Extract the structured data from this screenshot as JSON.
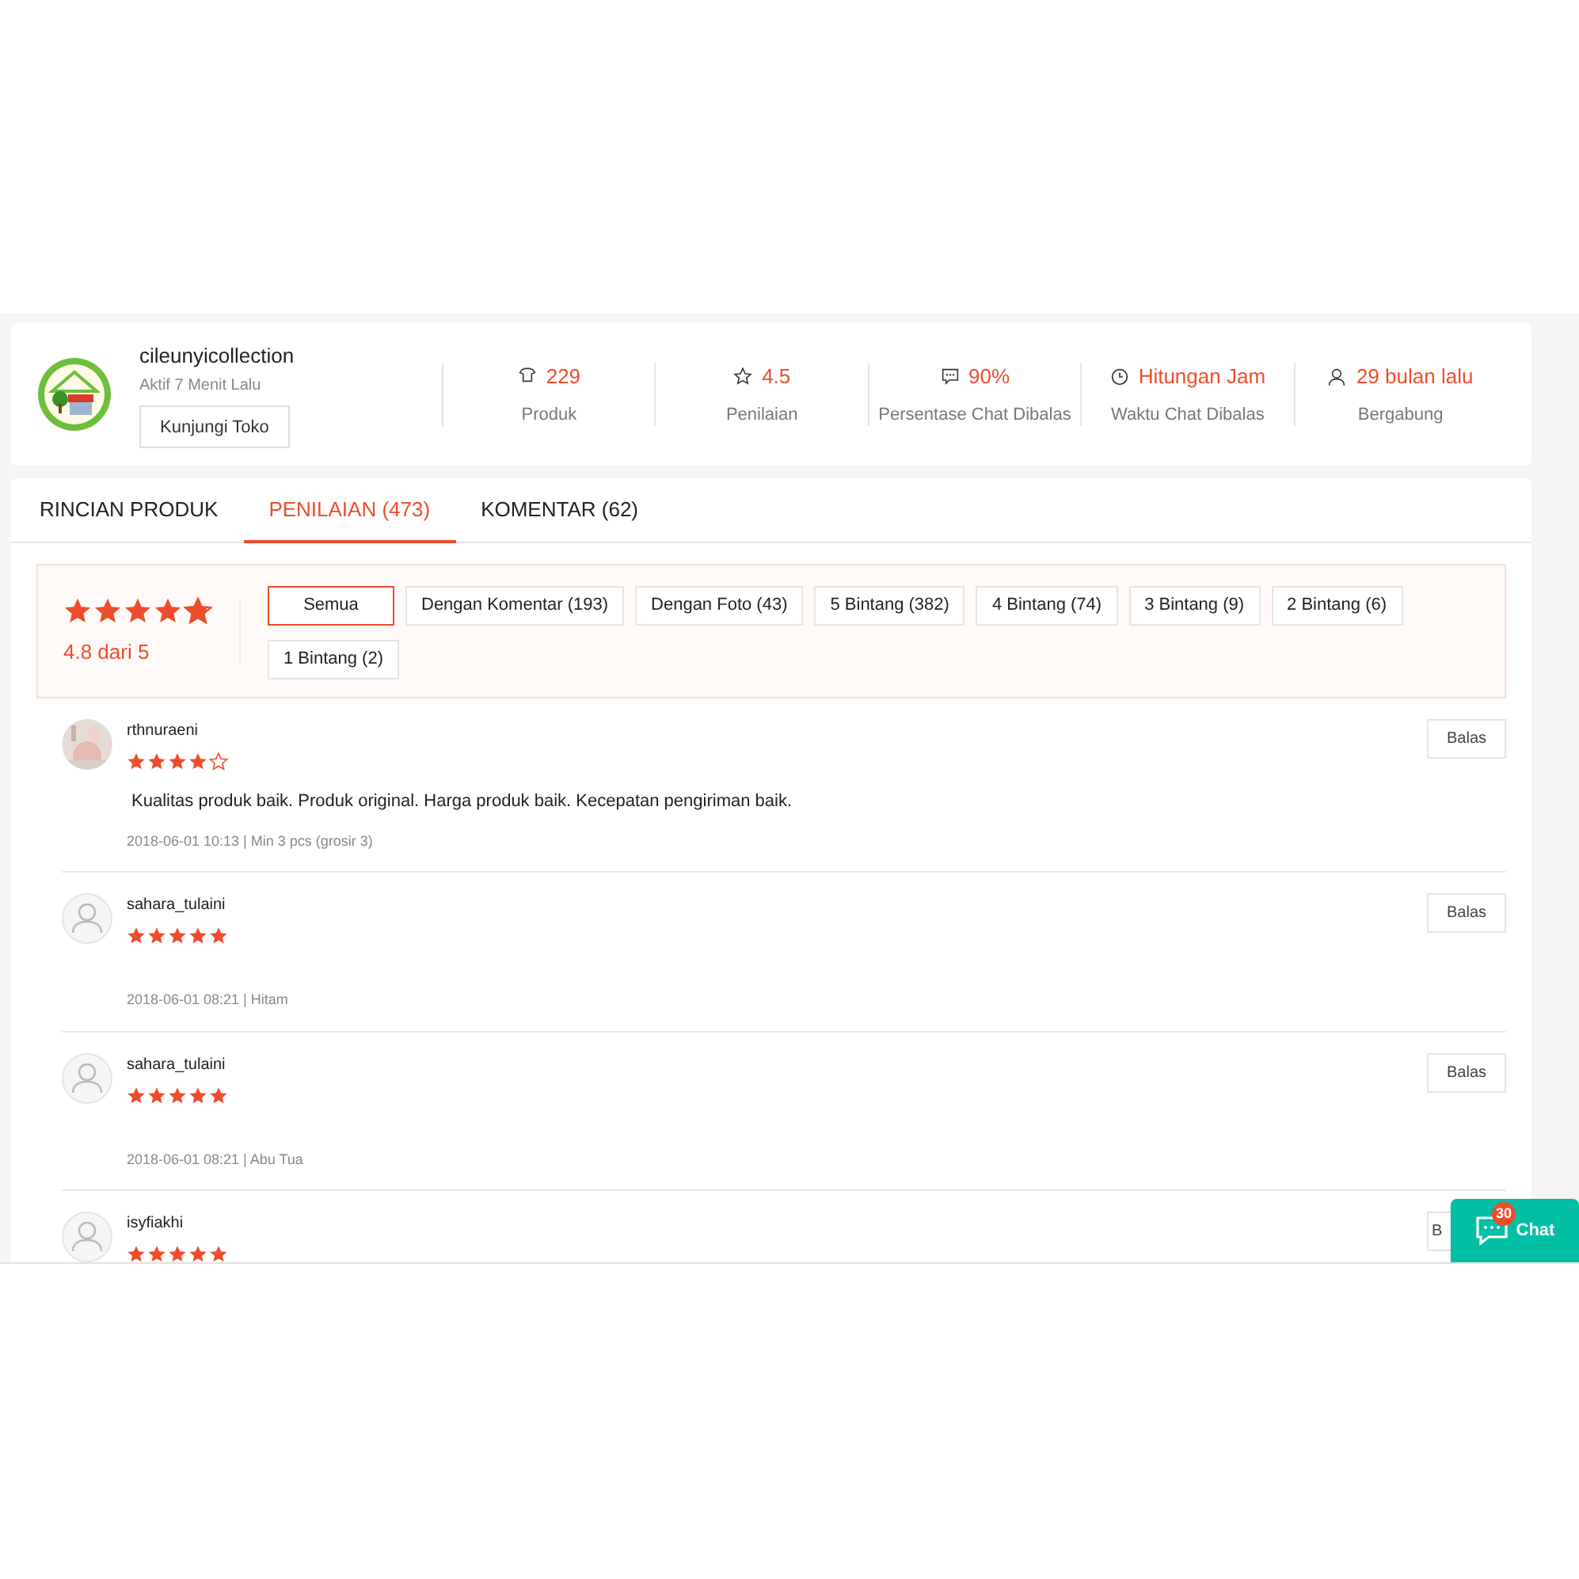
{
  "shop": {
    "name": "cileunyicollection",
    "status": "Aktif 7 Menit Lalu",
    "visit_button": "Kunjungi Toko"
  },
  "stats": [
    {
      "kind": "shirt",
      "value": "229",
      "label": "Produk"
    },
    {
      "kind": "star",
      "value": "4.5",
      "label": "Penilaian"
    },
    {
      "kind": "chat",
      "value": "90%",
      "label": "Persentase Chat Dibalas"
    },
    {
      "kind": "clock",
      "value": "Hitungan Jam",
      "label": "Waktu Chat Dibalas"
    },
    {
      "kind": "user",
      "value": "29 bulan lalu",
      "label": "Bergabung"
    }
  ],
  "tabs": [
    {
      "label": "RINCIAN PRODUK",
      "selected": false
    },
    {
      "label": "PENILAIAN (473)",
      "selected": true
    },
    {
      "label": "KOMENTAR (62)",
      "selected": false
    }
  ],
  "rating_summary": {
    "stars": 4.8,
    "text": "4.8 dari 5"
  },
  "filters": [
    {
      "label": "Semua",
      "selected": true
    },
    {
      "label": "Dengan Komentar (193)",
      "selected": false
    },
    {
      "label": "Dengan Foto (43)",
      "selected": false
    },
    {
      "label": "5 Bintang (382)",
      "selected": false
    },
    {
      "label": "4 Bintang (74)",
      "selected": false
    },
    {
      "label": "3 Bintang (9)",
      "selected": false
    },
    {
      "label": "2 Bintang (6)",
      "selected": false
    },
    {
      "label": "1 Bintang (2)",
      "selected": false
    }
  ],
  "reviews": [
    {
      "user": "rthnuraeni",
      "stars": 4,
      "comment": "Kualitas produk baik. Produk original. Harga produk baik. Kecepatan pengiriman baik.",
      "meta": "2018-06-01 10:13 | Min 3 pcs (grosir 3)",
      "reply": "Balas"
    },
    {
      "user": "sahara_tulaini",
      "avatar": {
        "kind": "default"
      },
      "stars": 5,
      "meta": "2018-06-01 08:21 | Hitam",
      "reply": "Balas"
    },
    {
      "user": "sahara_tulaini",
      "avatar": {
        "kind": "default"
      },
      "stars": 5,
      "meta": "2018-06-01 08:21 | Abu Tua",
      "reply": "Balas"
    },
    {
      "user": "isyfiakhi",
      "avatar": {
        "kind": "default"
      },
      "stars": 5,
      "reply": "B"
    }
  ],
  "chat_button": {
    "label": "Chat",
    "badge": "30"
  }
}
